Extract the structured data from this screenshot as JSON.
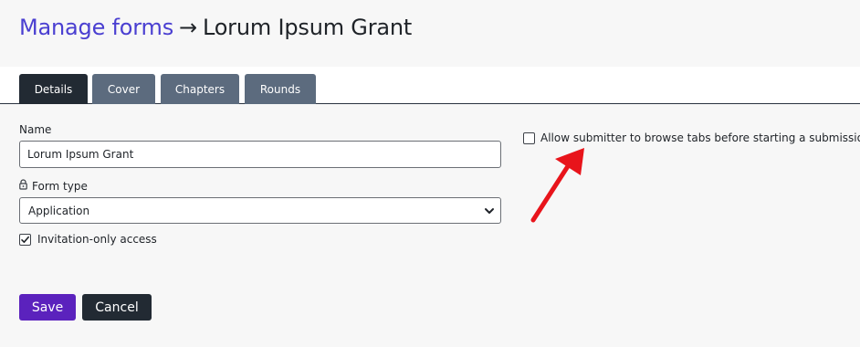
{
  "header": {
    "breadcrumb_link": "Manage forms",
    "separator": "→",
    "current_page": "Lorum Ipsum Grant"
  },
  "tabs": [
    {
      "label": "Details",
      "active": true
    },
    {
      "label": "Cover",
      "active": false
    },
    {
      "label": "Chapters",
      "active": false
    },
    {
      "label": "Rounds",
      "active": false
    }
  ],
  "form": {
    "name_label": "Name",
    "name_value": "Lorum Ipsum Grant",
    "form_type_label": "Form type",
    "form_type_value": "Application",
    "invitation_only_label": "Invitation-only access",
    "invitation_only_checked": true,
    "browse_tabs_label": "Allow submitter to browse tabs before starting a submission",
    "browse_tabs_checked": false
  },
  "actions": {
    "save_label": "Save",
    "cancel_label": "Cancel"
  },
  "icons": {
    "lock": "lock-icon",
    "select_chevron": "chevron-down-icon",
    "checkmark": "checkmark-icon"
  },
  "colors": {
    "breadcrumb_link": "#4a3fd1",
    "tab_active": "#222a33",
    "tab_inactive": "#5c6b7e",
    "save_button": "#5b22bd",
    "cancel_button": "#222a33",
    "annotation_arrow": "#e8141b"
  }
}
